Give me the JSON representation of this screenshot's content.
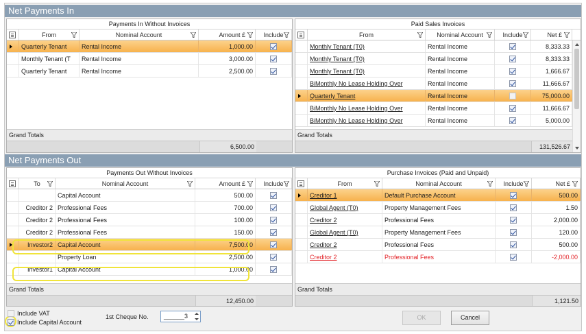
{
  "sections": {
    "in_title": "Net Payments In",
    "out_title": "Net Payments Out"
  },
  "grids": {
    "in_without": {
      "title": "Payments In Without Invoices",
      "headers": {
        "from": "From",
        "nominal": "Nominal Account",
        "amount": "Amount £",
        "include": "Include"
      },
      "rows": [
        {
          "from": "Quarterly Tenant",
          "nominal": "Rental Income",
          "amount": "1,000.00",
          "include": true,
          "selected": true
        },
        {
          "from": "Monthly Tenant (T",
          "nominal": "Rental Income",
          "amount": "3,000.00",
          "include": true,
          "selected": false
        },
        {
          "from": "Quarterly Tenant",
          "nominal": "Rental Income",
          "amount": "2,500.00",
          "include": true,
          "selected": false
        }
      ],
      "grand_totals_label": "Grand Totals",
      "grand_total": "6,500.00"
    },
    "sales_invoices": {
      "title": "Paid Sales Invoices",
      "headers": {
        "from": "From",
        "nominal": "Nominal Account",
        "include": "Include",
        "net": "Net £"
      },
      "rows": [
        {
          "from": "Monthly Tenant (T0)",
          "nominal": "Rental Income",
          "include": true,
          "net": "8,333.33",
          "selected": false
        },
        {
          "from": "Monthly Tenant (T0)",
          "nominal": "Rental Income",
          "include": true,
          "net": "8,333.33",
          "selected": false
        },
        {
          "from": "Monthly Tenant (T0)",
          "nominal": "Rental Income",
          "include": true,
          "net": "1,666.67",
          "selected": false
        },
        {
          "from": "BiMonthly No Lease Holding Over",
          "nominal": "Rental Income",
          "include": true,
          "net": "11,666.67",
          "selected": false
        },
        {
          "from": "Quarterly Tenant",
          "nominal": "Rental Income",
          "include": false,
          "net": "75,000.00",
          "selected": true
        },
        {
          "from": "BiMonthly No Lease Holding Over",
          "nominal": "Rental Income",
          "include": true,
          "net": "11,666.67",
          "selected": false
        },
        {
          "from": "BiMonthly No Lease Holding Over",
          "nominal": "Rental Income",
          "include": true,
          "net": "5,000.00",
          "selected": false
        }
      ],
      "grand_totals_label": "Grand Totals",
      "grand_total": "131,526.67"
    },
    "out_without": {
      "title": "Payments Out Without Invoices",
      "headers": {
        "to": "To",
        "nominal": "Nominal Account",
        "amount": "Amount £",
        "include": "Include"
      },
      "rows": [
        {
          "to": "",
          "nominal": "Capital Account",
          "amount": "500.00",
          "include": true,
          "selected": false
        },
        {
          "to": "Creditor 2",
          "nominal": "Professional Fees",
          "amount": "700.00",
          "include": true,
          "selected": false
        },
        {
          "to": "Creditor 2",
          "nominal": "Professional Fees",
          "amount": "100.00",
          "include": true,
          "selected": false
        },
        {
          "to": "Creditor 2",
          "nominal": "Professional Fees",
          "amount": "150.00",
          "include": true,
          "selected": false
        },
        {
          "to": "Investor2",
          "nominal": "Capital Account",
          "amount": "7,500.00",
          "include": true,
          "selected": true
        },
        {
          "to": "",
          "nominal": "Property Loan",
          "amount": "2,500.00",
          "include": true,
          "selected": false
        },
        {
          "to": "Investor1",
          "nominal": "Capital Account",
          "amount": "1,000.00",
          "include": true,
          "selected": false
        }
      ],
      "grand_totals_label": "Grand Totals",
      "grand_total": "12,450.00"
    },
    "purchase_invoices": {
      "title": "Purchase Invoices (Paid and Unpaid)",
      "headers": {
        "from": "From",
        "nominal": "Nominal Account",
        "include": "Include",
        "net": "Net £"
      },
      "rows": [
        {
          "from": "Creditor 1",
          "nominal": "Default Purchase Account",
          "include": true,
          "net": "500.00",
          "selected": true,
          "negative": false
        },
        {
          "from": "Global Agent (T0)",
          "nominal": "Property Management Fees",
          "include": true,
          "net": "1.50",
          "selected": false,
          "negative": false
        },
        {
          "from": "Creditor 2",
          "nominal": "Professional Fees",
          "include": true,
          "net": "2,000.00",
          "selected": false,
          "negative": false
        },
        {
          "from": "Global Agent (T0)",
          "nominal": "Property Management Fees",
          "include": true,
          "net": "120.00",
          "selected": false,
          "negative": false
        },
        {
          "from": "Creditor 2",
          "nominal": "Professional Fees",
          "include": true,
          "net": "500.00",
          "selected": false,
          "negative": false
        },
        {
          "from": "Creditor 2",
          "nominal": "Professional Fees",
          "include": true,
          "net": "-2,000.00",
          "selected": false,
          "negative": true
        }
      ],
      "grand_totals_label": "Grand Totals",
      "grand_total": "1,121.50"
    }
  },
  "bottom": {
    "include_vat_label": "Include VAT",
    "include_vat": false,
    "include_capital_label": "Include Capital Account",
    "include_capital": true,
    "cheque_label": "1st Cheque No.",
    "cheque_value": "______3",
    "ok_label": "OK",
    "cancel_label": "Cancel"
  },
  "colors": {
    "section_bar": "#8a9fb3",
    "selected_row": "#f7b24d",
    "negative_text": "#e3262b",
    "highlight": "#f0e43a"
  }
}
